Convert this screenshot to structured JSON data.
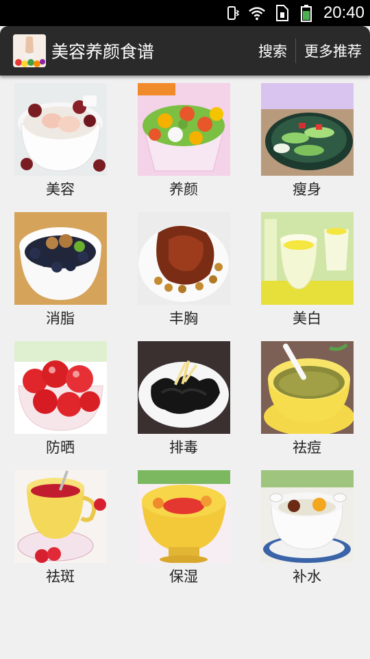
{
  "status_bar": {
    "time": "20:40",
    "icons": [
      "vibrate-icon",
      "wifi-icon",
      "sim-icon",
      "battery-icon"
    ]
  },
  "action_bar": {
    "title": "美容养颜食谱",
    "actions": [
      "搜索",
      "更多推荐"
    ]
  },
  "categories": [
    {
      "label": "美容",
      "icon": "dessert-soup-icon"
    },
    {
      "label": "养颜",
      "icon": "fruit-salad-icon"
    },
    {
      "label": "瘦身",
      "icon": "vegetable-dish-icon"
    },
    {
      "label": "消脂",
      "icon": "fruit-bowl-icon"
    },
    {
      "label": "丰胸",
      "icon": "braised-pork-icon"
    },
    {
      "label": "美白",
      "icon": "lemon-drink-icon"
    },
    {
      "label": "防晒",
      "icon": "tomato-bowl-icon"
    },
    {
      "label": "排毒",
      "icon": "black-fungus-icon"
    },
    {
      "label": "祛痘",
      "icon": "mung-bean-soup-icon"
    },
    {
      "label": "祛斑",
      "icon": "red-tea-cup-icon"
    },
    {
      "label": "保湿",
      "icon": "fruit-jelly-icon"
    },
    {
      "label": "补水",
      "icon": "sweet-soup-pot-icon"
    }
  ]
}
